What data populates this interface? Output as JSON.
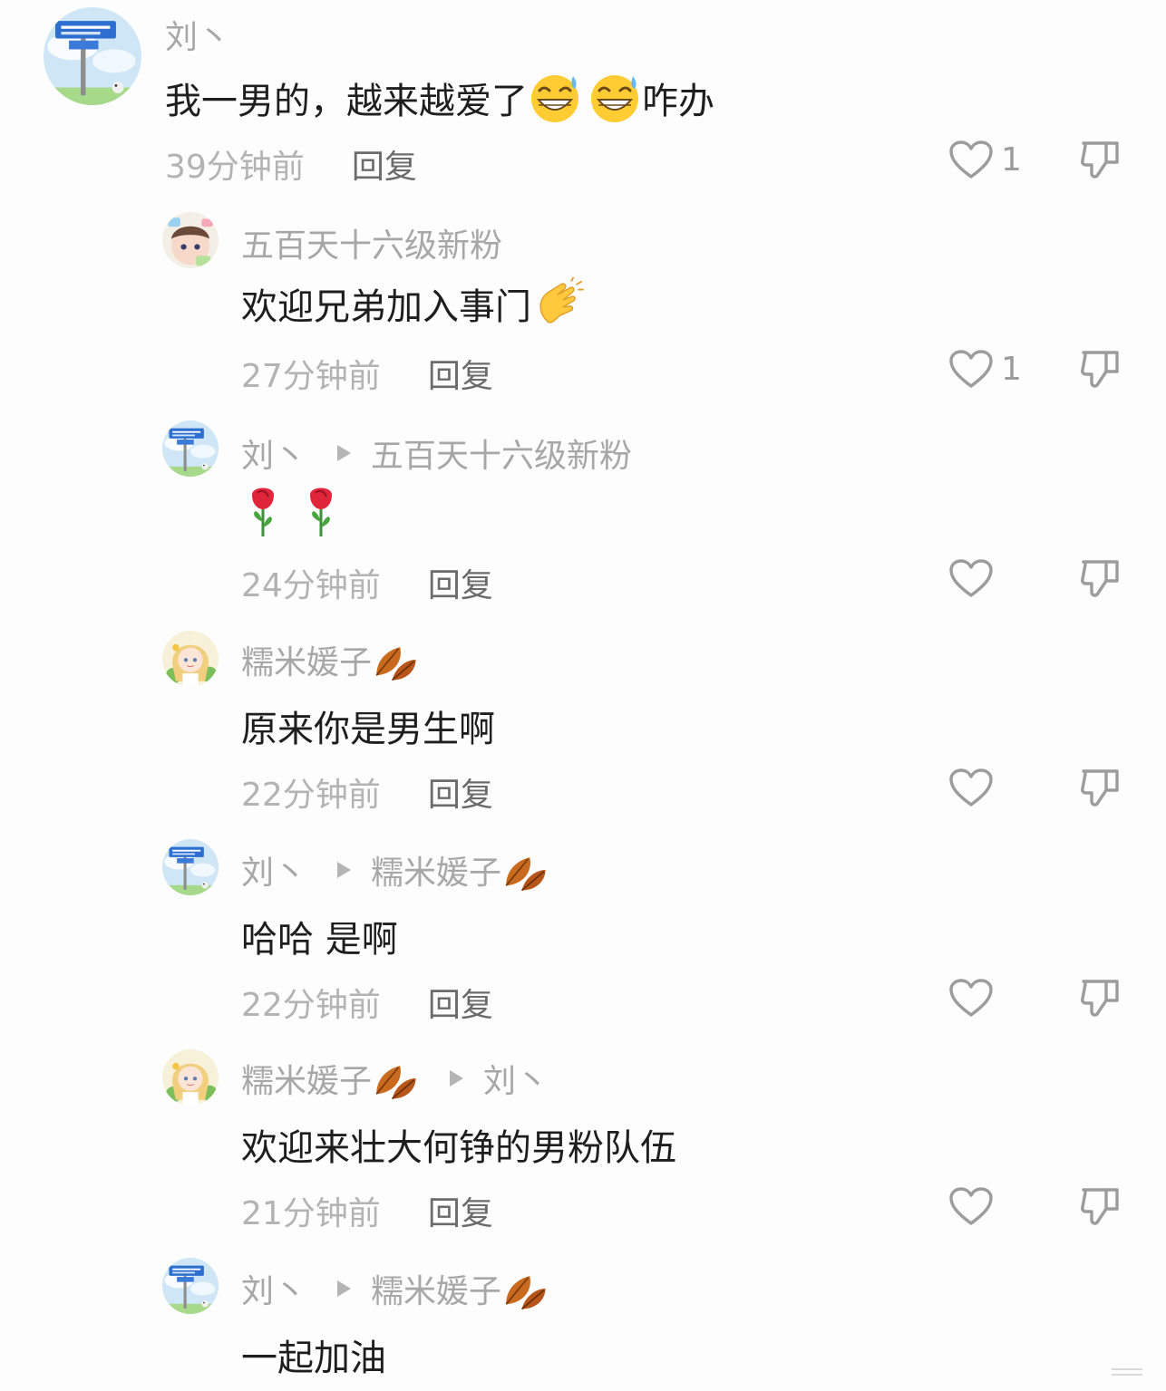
{
  "comments": [
    {
      "author": "刘丶",
      "text": "我一男的，越来越爱了",
      "text_suffix": "咋办",
      "time": "39分钟前",
      "reply": "回复",
      "likes": "1"
    },
    {
      "author": "五百天十六级新粉",
      "text": "欢迎兄弟加入事门",
      "time": "27分钟前",
      "reply": "回复",
      "likes": "1"
    },
    {
      "author": "刘丶",
      "reply_to": "五百天十六级新粉",
      "text": "",
      "time": "24分钟前",
      "reply": "回复"
    },
    {
      "author": "糯米媛子",
      "text": "原来你是男生啊",
      "time": "22分钟前",
      "reply": "回复"
    },
    {
      "author": "刘丶",
      "reply_to": "糯米媛子",
      "text": "哈哈 是啊",
      "time": "22分钟前",
      "reply": "回复"
    },
    {
      "author": "糯米媛子",
      "reply_to": "刘丶",
      "text": "欢迎来壮大何铮的男粉队伍",
      "time": "21分钟前",
      "reply": "回复"
    },
    {
      "author": "刘丶",
      "reply_to": "糯米媛子",
      "text": "一起加油"
    }
  ],
  "icons": {
    "like": "heart-outline-icon",
    "dislike": "thumbs-down-outline-icon",
    "reply_arrow": "play-triangle-icon",
    "emojis": [
      "grinning-sweat-emoji",
      "clapping-hands-emoji",
      "rose-emoji",
      "fallen-leaf-emoji"
    ]
  },
  "colors": {
    "background": "#fdfdfd",
    "username": "#a7a7a7",
    "content": "#1e1e1e",
    "time": "#b3b3b3",
    "reply": "#6b6b6b",
    "icon": "#9c9c9c"
  }
}
